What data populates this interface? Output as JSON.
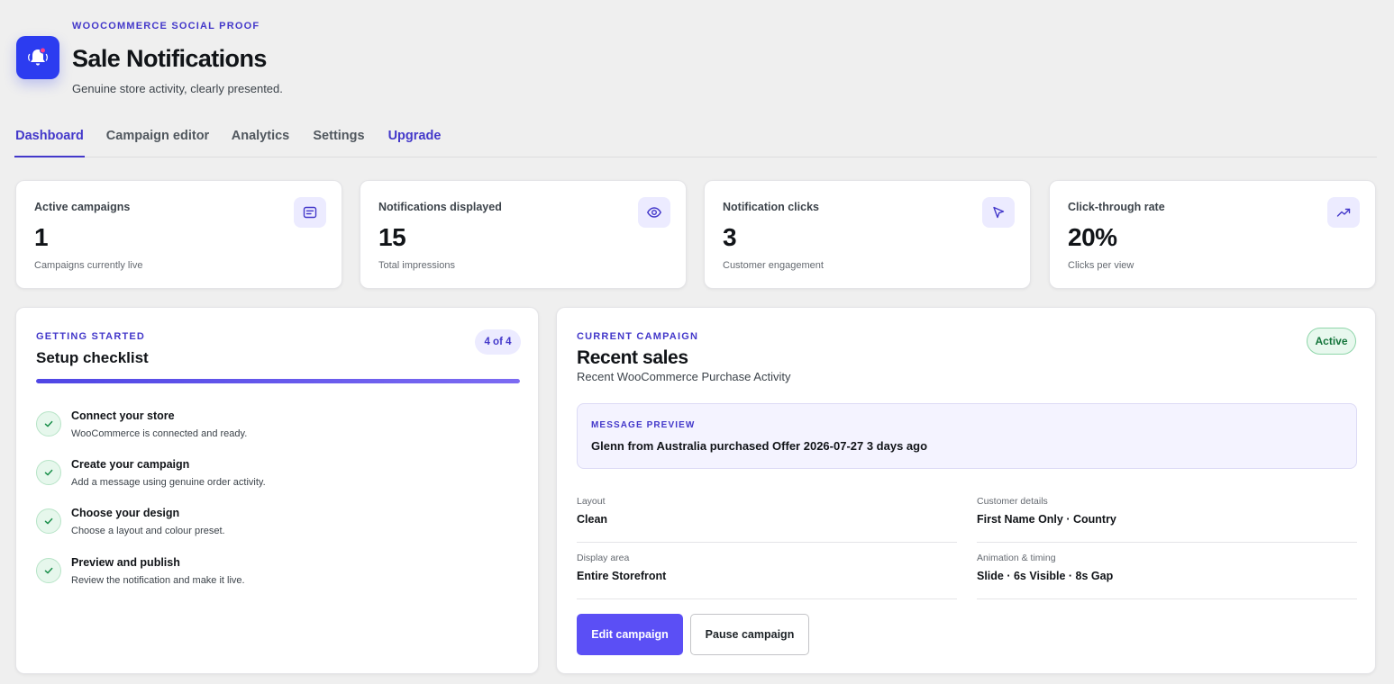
{
  "header": {
    "eyebrow": "WOOCOMMERCE SOCIAL PROOF",
    "title": "Sale Notifications",
    "subtitle": "Genuine store activity, clearly presented.",
    "icon": "bell-icon"
  },
  "tabs": [
    {
      "label": "Dashboard",
      "active": true
    },
    {
      "label": "Campaign editor",
      "active": false
    },
    {
      "label": "Analytics",
      "active": false
    },
    {
      "label": "Settings",
      "active": false
    },
    {
      "label": "Upgrade",
      "active": false
    }
  ],
  "stats": [
    {
      "label": "Active campaigns",
      "value": "1",
      "sub": "Campaigns currently live",
      "icon": "message-icon"
    },
    {
      "label": "Notifications displayed",
      "value": "15",
      "sub": "Total impressions",
      "icon": "eye-icon"
    },
    {
      "label": "Notification clicks",
      "value": "3",
      "sub": "Customer engagement",
      "icon": "cursor-icon"
    },
    {
      "label": "Click-through rate",
      "value": "20%",
      "sub": "Clicks per view",
      "icon": "trending-up-icon"
    }
  ],
  "checklist": {
    "eyebrow": "GETTING STARTED",
    "title": "Setup checklist",
    "count": "4 of 4",
    "progress": 1.0,
    "items": [
      {
        "title": "Connect your store",
        "desc": "WooCommerce is connected and ready."
      },
      {
        "title": "Create your campaign",
        "desc": "Add a message using genuine order activity."
      },
      {
        "title": "Choose your design",
        "desc": "Choose a layout and colour preset."
      },
      {
        "title": "Preview and publish",
        "desc": "Review the notification and make it live."
      }
    ]
  },
  "campaign": {
    "eyebrow": "CURRENT CAMPAIGN",
    "title": "Recent sales",
    "subtitle": "Recent WooCommerce Purchase Activity",
    "status": "Active",
    "preview_label": "MESSAGE PREVIEW",
    "preview_text": "Glenn from Australia purchased Offer 2026-07-27 3 days ago",
    "details": [
      {
        "label": "Layout",
        "value": "Clean"
      },
      {
        "label": "Customer details",
        "value": "First Name Only · Country"
      },
      {
        "label": "Display area",
        "value": "Entire Storefront"
      },
      {
        "label": "Animation & timing",
        "value": "Slide · 6s Visible · 8s Gap"
      }
    ],
    "edit_label": "Edit campaign",
    "pause_label": "Pause campaign"
  },
  "colors": {
    "accent": "#4338ca",
    "primary_button": "#5b4ff5",
    "app_icon": "#2c3cf0",
    "success": "#14753b"
  }
}
